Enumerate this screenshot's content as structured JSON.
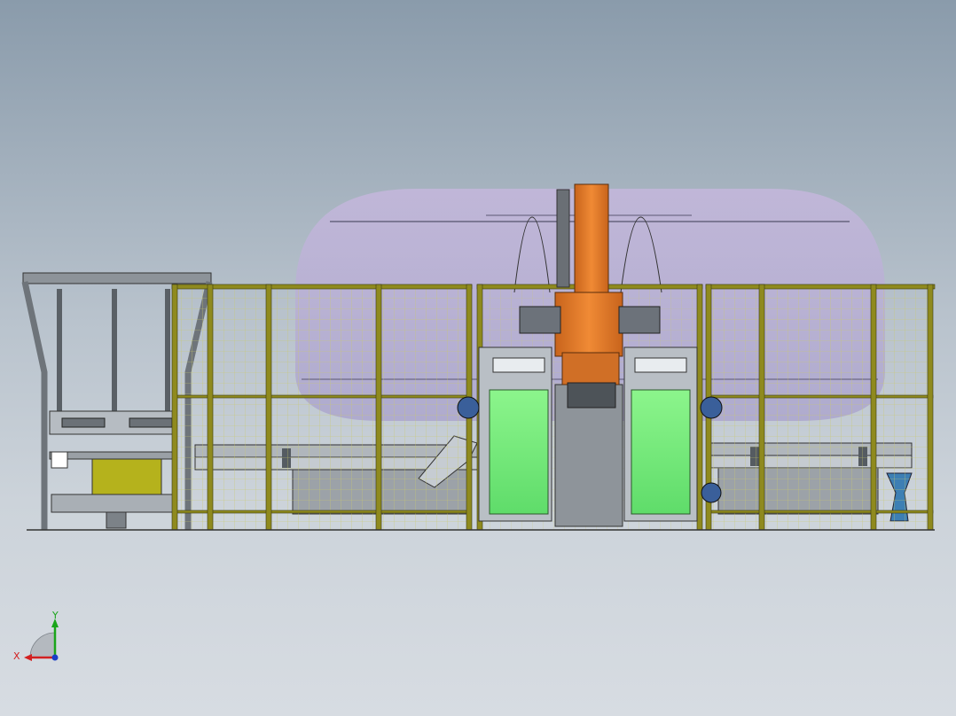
{
  "viewport": {
    "background_top": "#8a9bab",
    "background_bottom": "#d7dce2",
    "description_colors": {
      "fence_frame": "#8f8a1e",
      "fence_mesh": "#c8c86a",
      "robot": "#e07a2a",
      "envelope": "#b8a8d8",
      "belt": "#7ef07e",
      "motor": "#3a5f9a",
      "steel": "#9aa0a6"
    }
  },
  "triad": {
    "x_label": "X",
    "y_label": "Y",
    "x_axis_color": "#d32020",
    "y_axis_color": "#1aa51a",
    "z_axis_color": "#1a3fc8"
  }
}
